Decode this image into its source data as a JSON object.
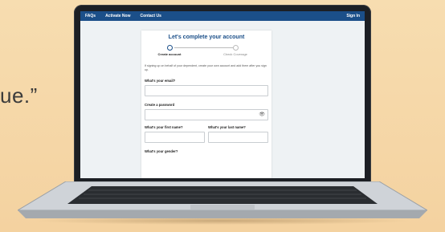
{
  "background": {
    "quote_fragment": "ue.”"
  },
  "nav": {
    "items": [
      "FAQs",
      "Activate Now",
      "Contact Us"
    ],
    "sign_in": "Sign In",
    "color": "#1b4f89"
  },
  "form": {
    "title": "Let's complete your account",
    "steps": [
      {
        "label": "Create account"
      },
      {
        "label": "Check Coverage"
      }
    ],
    "note": "If signing up on behalf of your dependent, create your own account and add them after you sign up.",
    "email_label": "What's your email?",
    "password_label": "Create a password",
    "password_icon": "eye-slash-icon",
    "first_name_label": "What's your first name?",
    "last_name_label": "What's your last name?",
    "gender_label": "What's your gender?"
  }
}
